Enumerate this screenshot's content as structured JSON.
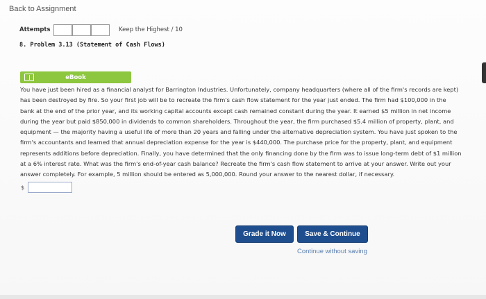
{
  "header": {
    "back_link": "Back to Assignment"
  },
  "attempts": {
    "label": "Attempts",
    "keep_label": "Keep the Highest / 10"
  },
  "problem": {
    "title": "8. Problem 3.13 (Statement of Cash Flows)",
    "ebook_label": "eBook",
    "text": "You have just been hired as a financial analyst for Barrington Industries. Unfortunately, company headquarters (where all of the firm's records are kept)\nhas been destroyed by fire. So your first job will be to recreate the firm's cash flow statement for the year just ended. The firm had $100,000 in the\nbank at the end of the prior year, and its working capital accounts except cash remained constant during the year. It earned $5 million in net income\nduring the year but paid $850,000 in dividends to common shareholders. Throughout the year, the firm purchased $5.4 million of property, plant, and\nequipment — the majority having a useful life of more than 20 years and falling under the alternative depreciation system. You have just spoken to the\nfirm's accountants and learned that annual depreciation expense for the year is $440,000. The purchase price for the property, plant, and equipment\nrepresents additions before depreciation. Finally, you have determined that the only financing done by the firm was to issue long-term debt of $1 million\nat a 6% interest rate. What was the firm's end-of-year cash balance? Recreate the firm's cash flow statement to arrive at your answer. Write out your\nanswer completely. For example, 5 million should be entered as 5,000,000. Round your answer to the nearest dollar, if necessary."
  },
  "answer": {
    "currency": "$",
    "value": ""
  },
  "actions": {
    "grade_label": "Grade it Now",
    "save_label": "Save & Continue",
    "continue_label": "Continue without saving"
  },
  "colors": {
    "ebook_bar": "#8dc63f",
    "button": "#1f4e8f",
    "link": "#5a7fb0"
  }
}
